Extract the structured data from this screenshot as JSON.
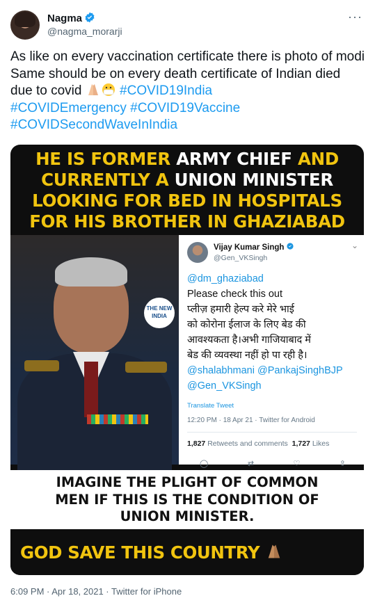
{
  "author": {
    "name": "Nagma",
    "handle": "@nagma_morarji"
  },
  "more_glyph": "···",
  "tweet": {
    "text": "As like on every vaccination certificate there is photo of modi Same should be on every death certificate of Indian died due to covid",
    "hashtags": [
      "#COVID19India",
      "#COVIDEmergency",
      "#COVID19Vaccine",
      "#COVIDSecondWaveInIndia"
    ]
  },
  "image": {
    "headline": [
      {
        "yellow": "HE IS FORMER",
        "white": " ARMY CHIEF",
        "yellow2": " AND"
      },
      {
        "yellow": "CURRENTLY A",
        "white": " UNION MINISTER",
        "yellow2": ""
      },
      {
        "yellow": "LOOKING FOR BED IN HOSPITALS",
        "white": "",
        "yellow2": ""
      },
      {
        "yellow": "FOR HIS BROTHER IN GHAZIABAD",
        "white": "",
        "yellow2": ""
      }
    ],
    "logo_text": "THE NEW INDIA",
    "embedded_tweet": {
      "name": "Vijay Kumar Singh",
      "handle": "@Gen_VKSingh",
      "mention": "@dm_ghaziabad",
      "line1": "Please check this out",
      "hindi": [
        "प्लीज़ हमारी हेल्प करे मेरे भाई",
        "को कोरोना ईलाज के लिए बेड की",
        "आवश्यकता है।अभी गाजियाबाद में",
        "बेड की व्यवस्था नहीं हो पा रही है।"
      ],
      "mentions2": "@shalabhmani @PankajSinghBJP",
      "mentions3": "@Gen_VKSingh",
      "translate": "Translate Tweet",
      "time": "12:20 PM · 18 Apr 21 · Twitter for Android",
      "retweets": "1,827",
      "retweets_label": "Retweets and comments",
      "likes": "1,727",
      "likes_label": "Likes"
    },
    "caption": [
      "IMAGINE THE PLIGHT OF COMMON",
      "MEN IF THIS IS THE CONDITION OF",
      "UNION MINISTER."
    ],
    "footer": "GOD SAVE THIS COUNTRY"
  },
  "meta": "6:09 PM · Apr 18, 2021 · Twitter for iPhone",
  "colors": {
    "accent": "#1d9bf0",
    "headline_yellow": "#f1c40f",
    "banner_bg": "#0e0e0e"
  }
}
